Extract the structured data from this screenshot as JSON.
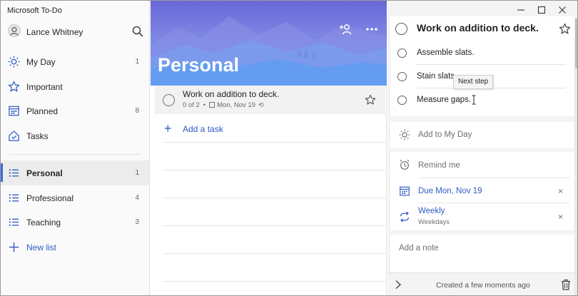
{
  "app": {
    "title": "Microsoft To-Do"
  },
  "user": {
    "name": "Lance Whitney"
  },
  "sidebar": {
    "items": [
      {
        "label": "My Day",
        "count": "1",
        "icon": "sun-icon"
      },
      {
        "label": "Important",
        "count": "",
        "icon": "star-icon"
      },
      {
        "label": "Planned",
        "count": "8",
        "icon": "calendar-icon"
      },
      {
        "label": "Tasks",
        "count": "",
        "icon": "home-icon"
      }
    ],
    "lists": [
      {
        "label": "Personal",
        "count": "1",
        "icon": "list-icon",
        "active": true
      },
      {
        "label": "Professional",
        "count": "4",
        "icon": "list-icon"
      },
      {
        "label": "Teaching",
        "count": "3",
        "icon": "list-icon"
      }
    ],
    "new_list": {
      "label": "New list",
      "icon": "plus-icon"
    }
  },
  "main": {
    "list_title": "Personal",
    "tasks": [
      {
        "title": "Work on addition to deck.",
        "steps": "0 of 2",
        "due": "Mon, Nov 19"
      }
    ],
    "add_task": "Add a task"
  },
  "detail": {
    "title": "Work on addition to deck.",
    "steps": [
      {
        "label": "Assemble slats."
      },
      {
        "label": "Stain slats"
      },
      {
        "label": "Measure gaps."
      }
    ],
    "tooltip": "Next step",
    "add_to_my_day": "Add to My Day",
    "remind_me": "Remind me",
    "due": "Due Mon, Nov 19",
    "repeat": {
      "label": "Weekly",
      "sub": "Weekdays"
    },
    "note_placeholder": "Add a note",
    "created": "Created a few moments ago",
    "remove_symbol": "×"
  },
  "colors": {
    "accent": "#2e5ac5",
    "active_bar": "#3e69d6",
    "banner_top": "#6a68d8",
    "banner_bottom": "#5797f0"
  }
}
